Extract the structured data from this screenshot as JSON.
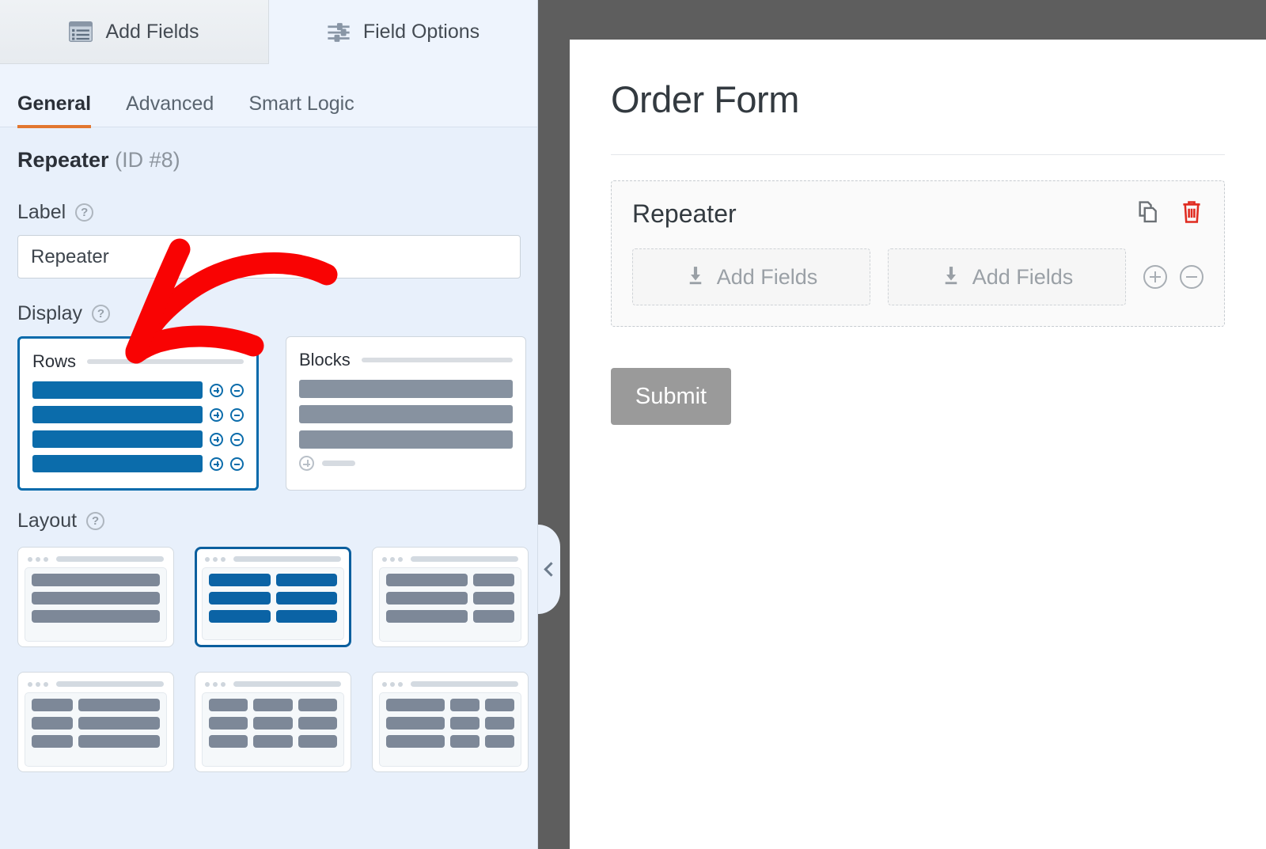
{
  "tabs": {
    "add_fields": {
      "label": "Add Fields",
      "icon": "list-form-icon"
    },
    "field_options": {
      "label": "Field Options",
      "icon": "sliders-icon"
    }
  },
  "subtabs": [
    {
      "label": "General",
      "selected": true
    },
    {
      "label": "Advanced",
      "selected": false
    },
    {
      "label": "Smart Logic",
      "selected": false
    }
  ],
  "field": {
    "name": "Repeater",
    "id_text": "(ID #8)",
    "label_caption": "Label",
    "label_value": "Repeater",
    "label_placeholder": "Label",
    "display_caption": "Display",
    "layout_caption": "Layout",
    "help_icon": "?"
  },
  "display_options": [
    {
      "name": "Rows",
      "selected": true,
      "rows": 4
    },
    {
      "name": "Blocks",
      "selected": false,
      "rows": 3
    }
  ],
  "layout_options": [
    {
      "id": "one-column",
      "selected": false,
      "columns": [
        [
          100
        ]
      ],
      "rows": 3
    },
    {
      "id": "two-column-even",
      "selected": true,
      "columns": [
        [
          50,
          50
        ]
      ],
      "rows": 3
    },
    {
      "id": "two-column-wide-narrow",
      "selected": false,
      "columns": [
        [
          66,
          34
        ]
      ],
      "rows": 3
    },
    {
      "id": "two-column-narrow-wide",
      "selected": false,
      "columns": [
        [
          34,
          66
        ]
      ],
      "rows": 3
    },
    {
      "id": "three-column-even",
      "selected": false,
      "columns": [
        [
          33,
          33,
          33
        ]
      ],
      "rows": 3
    },
    {
      "id": "three-column-wide-narrow-narrow",
      "selected": false,
      "columns": [
        [
          50,
          25,
          25
        ]
      ],
      "rows": 3
    }
  ],
  "collapse_handle": {
    "icon": "chevron-left-icon"
  },
  "preview": {
    "form_title": "Order Form",
    "repeater": {
      "label": "Repeater",
      "duplicate_icon": "copy-icon",
      "delete_icon": "trash-icon",
      "add_fields_label": "Add Fields",
      "add_fields_icon": "download-arrow-icon",
      "add_row_icon": "plus-circle-icon",
      "remove_row_icon": "minus-circle-icon"
    },
    "submit_label": "Submit"
  },
  "annotation": {
    "type": "red-arrow",
    "color": "#f90303",
    "points_to": "display-option-rows"
  },
  "colors": {
    "panel_bg": "#e8f0fb",
    "accent_orange": "#e27730",
    "accent_blue": "#0b6cab",
    "selected_border": "#066aab",
    "grey_bar": "#8792a0",
    "submit_grey": "#9a9a9a",
    "delete_red": "#e02b20",
    "backdrop": "#5e5e5e"
  }
}
